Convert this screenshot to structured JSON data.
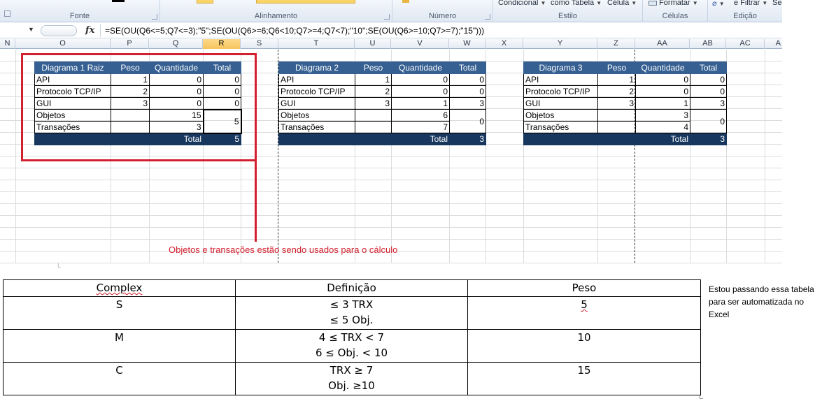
{
  "ribbon": {
    "groups": [
      {
        "label": "Fonte"
      },
      {
        "label": "Alinhamento"
      },
      {
        "label": "Número"
      },
      {
        "label": "Estilo"
      },
      {
        "label": "Células"
      },
      {
        "label": "Edição"
      }
    ],
    "top_buttons": {
      "conditional": "Condicional",
      "as_table": "como Tabela",
      "cell": "Célula",
      "format": "Formatar",
      "filter": "e Filtrar",
      "select": "Se"
    }
  },
  "formula_bar": {
    "fx": "fx",
    "formula": "=SE(OU(Q6<=5;Q7<=3);\"5\";SE(OU(Q6>=6;Q6<10;Q7>=4;Q7<7);\"10\";SE(OU(Q6>=10;Q7>=7);\"15\")))"
  },
  "columns": [
    "N",
    "O",
    "P",
    "Q",
    "R",
    "S",
    "T",
    "U",
    "V",
    "W",
    "X",
    "Y",
    "Z",
    "AA",
    "AB",
    "AC",
    "A"
  ],
  "active_column": "R",
  "tables": [
    {
      "header": [
        "Diagrama 1 Raiz",
        "Peso",
        "Quantidade",
        "Total"
      ],
      "rows": [
        {
          "label": "API",
          "peso": "1",
          "quantidade": "0",
          "total": "0"
        },
        {
          "label": "Protocolo TCP/IP",
          "peso": "2",
          "quantidade": "0",
          "total": "0"
        },
        {
          "label": "GUI",
          "peso": "3",
          "quantidade": "0",
          "total": "0"
        }
      ],
      "objetos": {
        "label": "Objetos",
        "quantidade": "15"
      },
      "transacoes": {
        "label": "Transações",
        "quantidade": "3"
      },
      "merged_total": "5",
      "footer": {
        "label": "Total",
        "value": "5"
      }
    },
    {
      "header": [
        "Diagrama 2",
        "Peso",
        "Quantidade",
        "Total"
      ],
      "rows": [
        {
          "label": "API",
          "peso": "1",
          "quantidade": "0",
          "total": "0"
        },
        {
          "label": "Protocolo TCP/IP",
          "peso": "2",
          "quantidade": "0",
          "total": "0"
        },
        {
          "label": "GUI",
          "peso": "3",
          "quantidade": "1",
          "total": "3"
        }
      ],
      "objetos": {
        "label": "Objetos",
        "quantidade": "6"
      },
      "transacoes": {
        "label": "Transações",
        "quantidade": "7"
      },
      "merged_total": "0",
      "footer": {
        "label": "Total",
        "value": "3"
      }
    },
    {
      "header": [
        "Diagrama 3",
        "Peso",
        "Quantidade",
        "Total"
      ],
      "rows": [
        {
          "label": "API",
          "peso": "1",
          "quantidade": "0",
          "total": "0"
        },
        {
          "label": "Protocolo TCP/IP",
          "peso": "2",
          "quantidade": "0",
          "total": "0"
        },
        {
          "label": "GUI",
          "peso": "3",
          "quantidade": "1",
          "total": "3"
        }
      ],
      "objetos": {
        "label": "Objetos",
        "quantidade": "3"
      },
      "transacoes": {
        "label": "Transações",
        "quantidade": "4"
      },
      "merged_total": "0",
      "footer": {
        "label": "Total",
        "value": "3"
      }
    }
  ],
  "annotation": "Objetos e transações estão sendo usados para o cálculo",
  "complexity_table": {
    "header": [
      "Complex",
      "Definição",
      "Peso"
    ],
    "rows": [
      {
        "complex": "S",
        "def1": "≤ 3 TRX",
        "def2": "≤ 5 Obj.",
        "peso": "5"
      },
      {
        "complex": "M",
        "def1": "4 ≤ TRX < 7",
        "def2": "6 ≤ Obj. < 10",
        "peso": "10"
      },
      {
        "complex": "C",
        "def1": "TRX ≥ 7",
        "def2": "Obj. ≥10",
        "peso": "15"
      }
    ]
  },
  "note": "Estou passando essa tabela para ser automatizada no Excel",
  "colors": {
    "header_blue": "#366092",
    "footer_navy": "#17375e",
    "annotation_red": "#d3202e"
  }
}
